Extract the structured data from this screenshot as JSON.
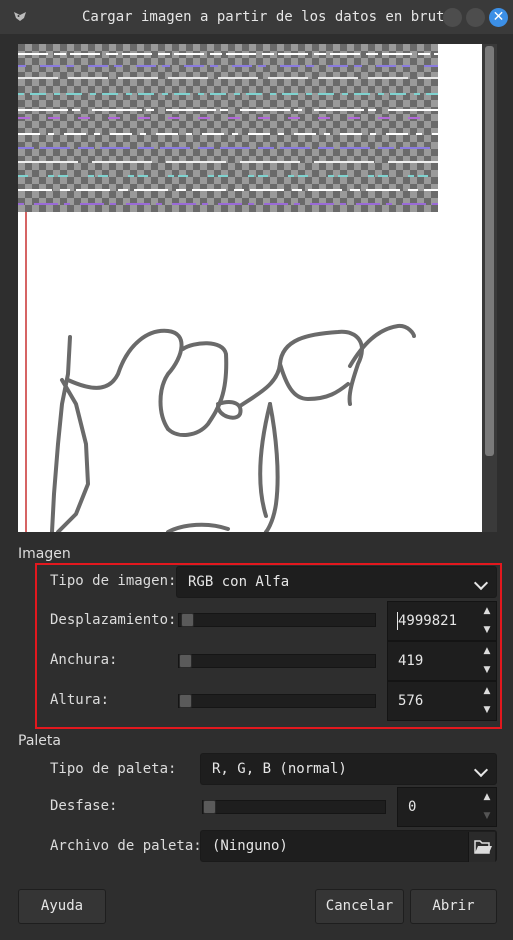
{
  "window": {
    "title": "Cargar imagen a partir de los datos en bruto",
    "icons": [
      "gimp-icon",
      "minimize-icon",
      "maximize-icon",
      "close-icon"
    ]
  },
  "image_section": {
    "label": "Imagen",
    "type_label": "Tipo de imagen:",
    "type_value": "RGB con Alfa",
    "offset_label": "Desplazamiento:",
    "offset_value": "4999821",
    "width_label": "Anchura:",
    "width_value": "419",
    "height_label": "Altura:",
    "height_value": "576"
  },
  "palette_section": {
    "label": "Paleta",
    "type_label": "Tipo de paleta:",
    "type_value": "R, G, B (normal)",
    "offset_label": "Desfase:",
    "offset_value": "0",
    "file_label": "Archivo de paleta:",
    "file_value": "(Ninguno)"
  },
  "buttons": {
    "help": "Ayuda",
    "cancel": "Cancelar",
    "open": "Abrir"
  },
  "colors": {
    "highlight_frame": "#e3181e",
    "close_button": "#3c8fe6"
  }
}
